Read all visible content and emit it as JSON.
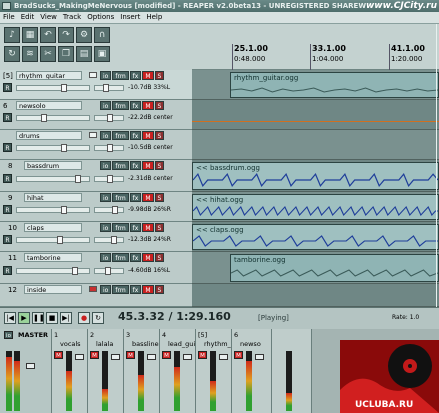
{
  "window": {
    "title": "BradSucks_MakingMeNervous [modified] - REAPER v2.0beta13 - UNREGISTERED SHAREW",
    "watermark": "www.CJCity.ru"
  },
  "menu": [
    "File",
    "Edit",
    "View",
    "Track",
    "Options",
    "Insert",
    "Help"
  ],
  "toolbar": {
    "buttons": [
      "metronome-icon",
      "grid-icon",
      "undo-icon",
      "redo-icon",
      "settings-icon",
      "snap-icon",
      "loop-icon",
      "ripple-icon",
      "cut-icon",
      "copy-icon",
      "paste-icon",
      "lock-icon"
    ]
  },
  "track_button_labels": {
    "io": "io",
    "fx": "fx",
    "trim": "fx",
    "mute": "M",
    "solo": "S",
    "rec": "R"
  },
  "tracks": [
    {
      "num": "[5]",
      "name": "rhythm_guitar",
      "volume": "-10.7dB 33%L",
      "volume_level": 0.62,
      "pan_level": 0.32,
      "selected": true,
      "has_fold": true
    },
    {
      "num": "6",
      "name": "newsolo",
      "volume": "-22.2dB center",
      "volume_level": 0.35,
      "pan_level": 0.5,
      "selected": false,
      "has_fold": false
    },
    {
      "num": "",
      "name": "drums",
      "volume": "-10.5dB center",
      "volume_level": 0.62,
      "pan_level": 0.5,
      "selected": false,
      "has_fold": true
    },
    {
      "num": "8",
      "name": "bassdrum",
      "volume": "-2.31dB center",
      "volume_level": 0.82,
      "pan_level": 0.5,
      "selected": false,
      "has_fold": false
    },
    {
      "num": "9",
      "name": "hihat",
      "volume": "-9.98dB 26%R",
      "volume_level": 0.63,
      "pan_level": 0.63,
      "selected": false,
      "has_fold": false
    },
    {
      "num": "10",
      "name": "claps",
      "volume": "-12.3dB 24%R",
      "volume_level": 0.57,
      "pan_level": 0.62,
      "selected": false,
      "has_fold": false
    },
    {
      "num": "11",
      "name": "tamborine",
      "volume": "-4.60dB 16%L",
      "volume_level": 0.78,
      "pan_level": 0.42,
      "selected": false,
      "has_fold": false
    },
    {
      "num": "12",
      "name": "inside",
      "volume": "",
      "volume_level": 0.5,
      "pan_level": 0.5,
      "selected": false,
      "has_fold": true
    }
  ],
  "ruler": {
    "marks": [
      {
        "measure": "25.1.00",
        "time": "0:48.000"
      },
      {
        "measure": "33.1.00",
        "time": "1:04.000"
      },
      {
        "measure": "41.1.00",
        "time": "1:20.000"
      }
    ]
  },
  "items": [
    {
      "label": "rhythm_guitar.ogg"
    },
    {
      "label": "<< bassdrum.ogg"
    },
    {
      "label": "<< hihat.ogg"
    },
    {
      "label": "<< claps.ogg"
    },
    {
      "label": "tamborine.ogg"
    }
  ],
  "transport": {
    "time": "45.3.32 / 1:29.160",
    "status": "[Playing]",
    "rate_label": "Rate:",
    "rate_value": "1.0"
  },
  "mixer": {
    "master_label": "MASTER",
    "strips": [
      {
        "num": "1",
        "name": "vocals"
      },
      {
        "num": "2",
        "name": "lalala"
      },
      {
        "num": "3",
        "name": "bassline"
      },
      {
        "num": "4",
        "name": "lead_guitar"
      },
      {
        "num": "[5]",
        "name": "rhythm_guitar"
      },
      {
        "num": "6",
        "name": "newso"
      }
    ]
  },
  "logo_text": "UCLUBA.RU",
  "colors": {
    "mute": "#c82020",
    "item": "#8fb4b4",
    "playing_head": "#e8f0ef"
  }
}
